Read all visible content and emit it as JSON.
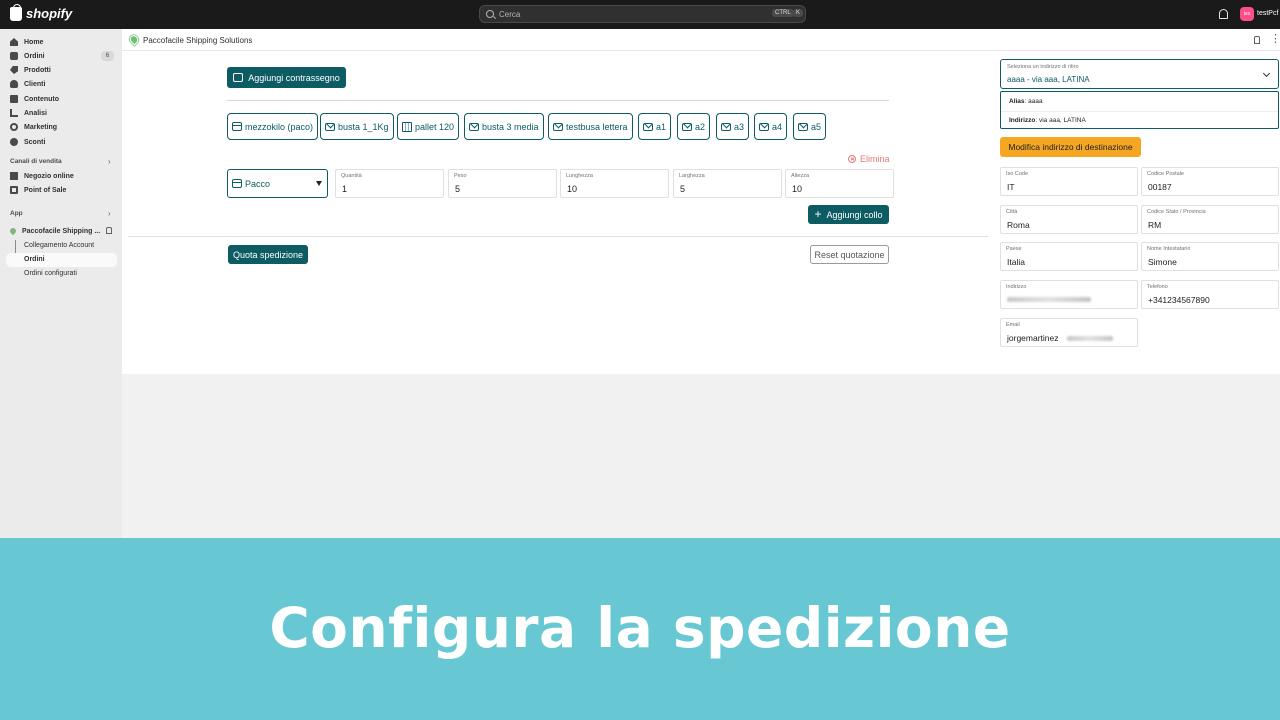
{
  "topbar": {
    "brand": "shopify",
    "search_placeholder": "Cerca",
    "shortcut_ctrl": "CTRL",
    "shortcut_k": "K",
    "avatar_initials": "tes",
    "store_name": "testPcf"
  },
  "sidebar": {
    "items": [
      {
        "label": "Home",
        "icon": "home-icon"
      },
      {
        "label": "Ordini",
        "icon": "orders-icon",
        "badge": "6"
      },
      {
        "label": "Prodotti",
        "icon": "tag-icon"
      },
      {
        "label": "Clienti",
        "icon": "user-icon"
      },
      {
        "label": "Contenuto",
        "icon": "content-icon"
      },
      {
        "label": "Analisi",
        "icon": "analytics-icon"
      },
      {
        "label": "Marketing",
        "icon": "marketing-icon"
      },
      {
        "label": "Sconti",
        "icon": "discount-icon"
      }
    ],
    "channels_label": "Canali di vendita",
    "channels": [
      {
        "label": "Negozio online",
        "icon": "online-store-icon"
      },
      {
        "label": "Point of Sale",
        "icon": "pos-icon"
      }
    ],
    "apps_label": "App",
    "app_name": "Paccofacile Shipping ...",
    "app_subitems": [
      "Collegamento Account",
      "Ordini",
      "Ordini configurati"
    ]
  },
  "app_header": {
    "title": "Paccofacile Shipping Solutions",
    "more": "⋮"
  },
  "main": {
    "cod_button": "Aggiungi contrassegno",
    "packages": [
      {
        "label": "mezzokilo (paco)",
        "icon": "box-icon"
      },
      {
        "label": "busta 1_1Kg",
        "icon": "envelope-icon"
      },
      {
        "label": "pallet 120",
        "icon": "pallet-icon"
      },
      {
        "label": "busta 3 media",
        "icon": "envelope-icon"
      },
      {
        "label": "testbusa lettera",
        "icon": "envelope-icon"
      },
      {
        "label": "a1",
        "icon": "envelope-icon"
      },
      {
        "label": "a2",
        "icon": "envelope-icon"
      },
      {
        "label": "a3",
        "icon": "envelope-icon"
      },
      {
        "label": "a4",
        "icon": "envelope-icon"
      },
      {
        "label": "a5",
        "icon": "envelope-icon"
      }
    ],
    "delete_label": "Elimina",
    "package_type": "Pacco",
    "fields": [
      {
        "label": "Quantità",
        "value": "1"
      },
      {
        "label": "Peso",
        "value": "5"
      },
      {
        "label": "Lunghezza",
        "value": "10"
      },
      {
        "label": "Larghezza",
        "value": "5"
      },
      {
        "label": "Altezza",
        "value": "10"
      }
    ],
    "add_parcel_button": "Aggiungi collo",
    "quote_button": "Quota spedizione",
    "reset_button": "Reset quotazione"
  },
  "return_address": {
    "select_label": "Seleziona un indirizzo di ritiro",
    "selected_value": "aaaa - via aaa, LATINA",
    "alias_label": "Alias",
    "alias_value": ": aaaa",
    "address_label": "Indirizzo",
    "address_value": ": via aaa, LATINA",
    "edit_button": "Modifica indirizzo di destinazione"
  },
  "destination": {
    "iso_code": {
      "label": "Iso Code",
      "value": "IT"
    },
    "postal_code": {
      "label": "Codice Postale",
      "value": "00187"
    },
    "city": {
      "label": "Città",
      "value": "Roma"
    },
    "province": {
      "label": "Codice Stato / Provincia",
      "value": "RM"
    },
    "country": {
      "label": "Paese",
      "value": "Italia"
    },
    "recipient": {
      "label": "Nome Intestatario",
      "value": "Simone"
    },
    "address": {
      "label": "Indirizzo",
      "value": ""
    },
    "phone": {
      "label": "Telefono",
      "value": "+341234567890"
    },
    "email": {
      "label": "Email",
      "value": "jorgemartinez"
    }
  },
  "banner": {
    "text": "Configura la spedizione"
  },
  "colors": {
    "primary": "#0d5b63",
    "accent_orange": "#f5a623",
    "banner": "#67c7d2",
    "danger": "#e57a7a"
  }
}
